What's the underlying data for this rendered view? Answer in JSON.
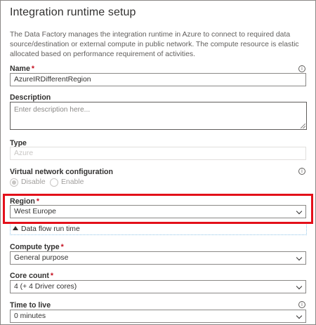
{
  "panel": {
    "title": "Integration runtime setup",
    "description": "The Data Factory manages the integration runtime in Azure to connect to required data source/destination or external compute in public network. The compute resource is elastic allocated based on performance requirement of activities."
  },
  "fields": {
    "name": {
      "label": "Name",
      "required_mark": "*",
      "value": "AzureIRDifferentRegion"
    },
    "description": {
      "label": "Description",
      "placeholder": "Enter description here..."
    },
    "type": {
      "label": "Type",
      "value": "Azure"
    },
    "vnet": {
      "label": "Virtual network configuration",
      "options": [
        "Disable",
        "Enable"
      ],
      "selected": "Disable"
    },
    "region": {
      "label": "Region",
      "required_mark": "*",
      "value": "West Europe"
    },
    "dataflow": {
      "label": "Data flow run time",
      "expanded": true
    },
    "compute_type": {
      "label": "Compute type",
      "required_mark": "*",
      "value": "General purpose"
    },
    "core_count": {
      "label": "Core count",
      "required_mark": "*",
      "value": "4 (+ 4 Driver cores)"
    },
    "ttl": {
      "label": "Time to live",
      "value": "0 minutes"
    }
  },
  "icons": {
    "info": "info-icon",
    "chevron": "chevron-down-icon",
    "collapse": "triangle-up-icon"
  },
  "colors": {
    "highlight": "#e3101a",
    "required": "#c50f1f"
  }
}
